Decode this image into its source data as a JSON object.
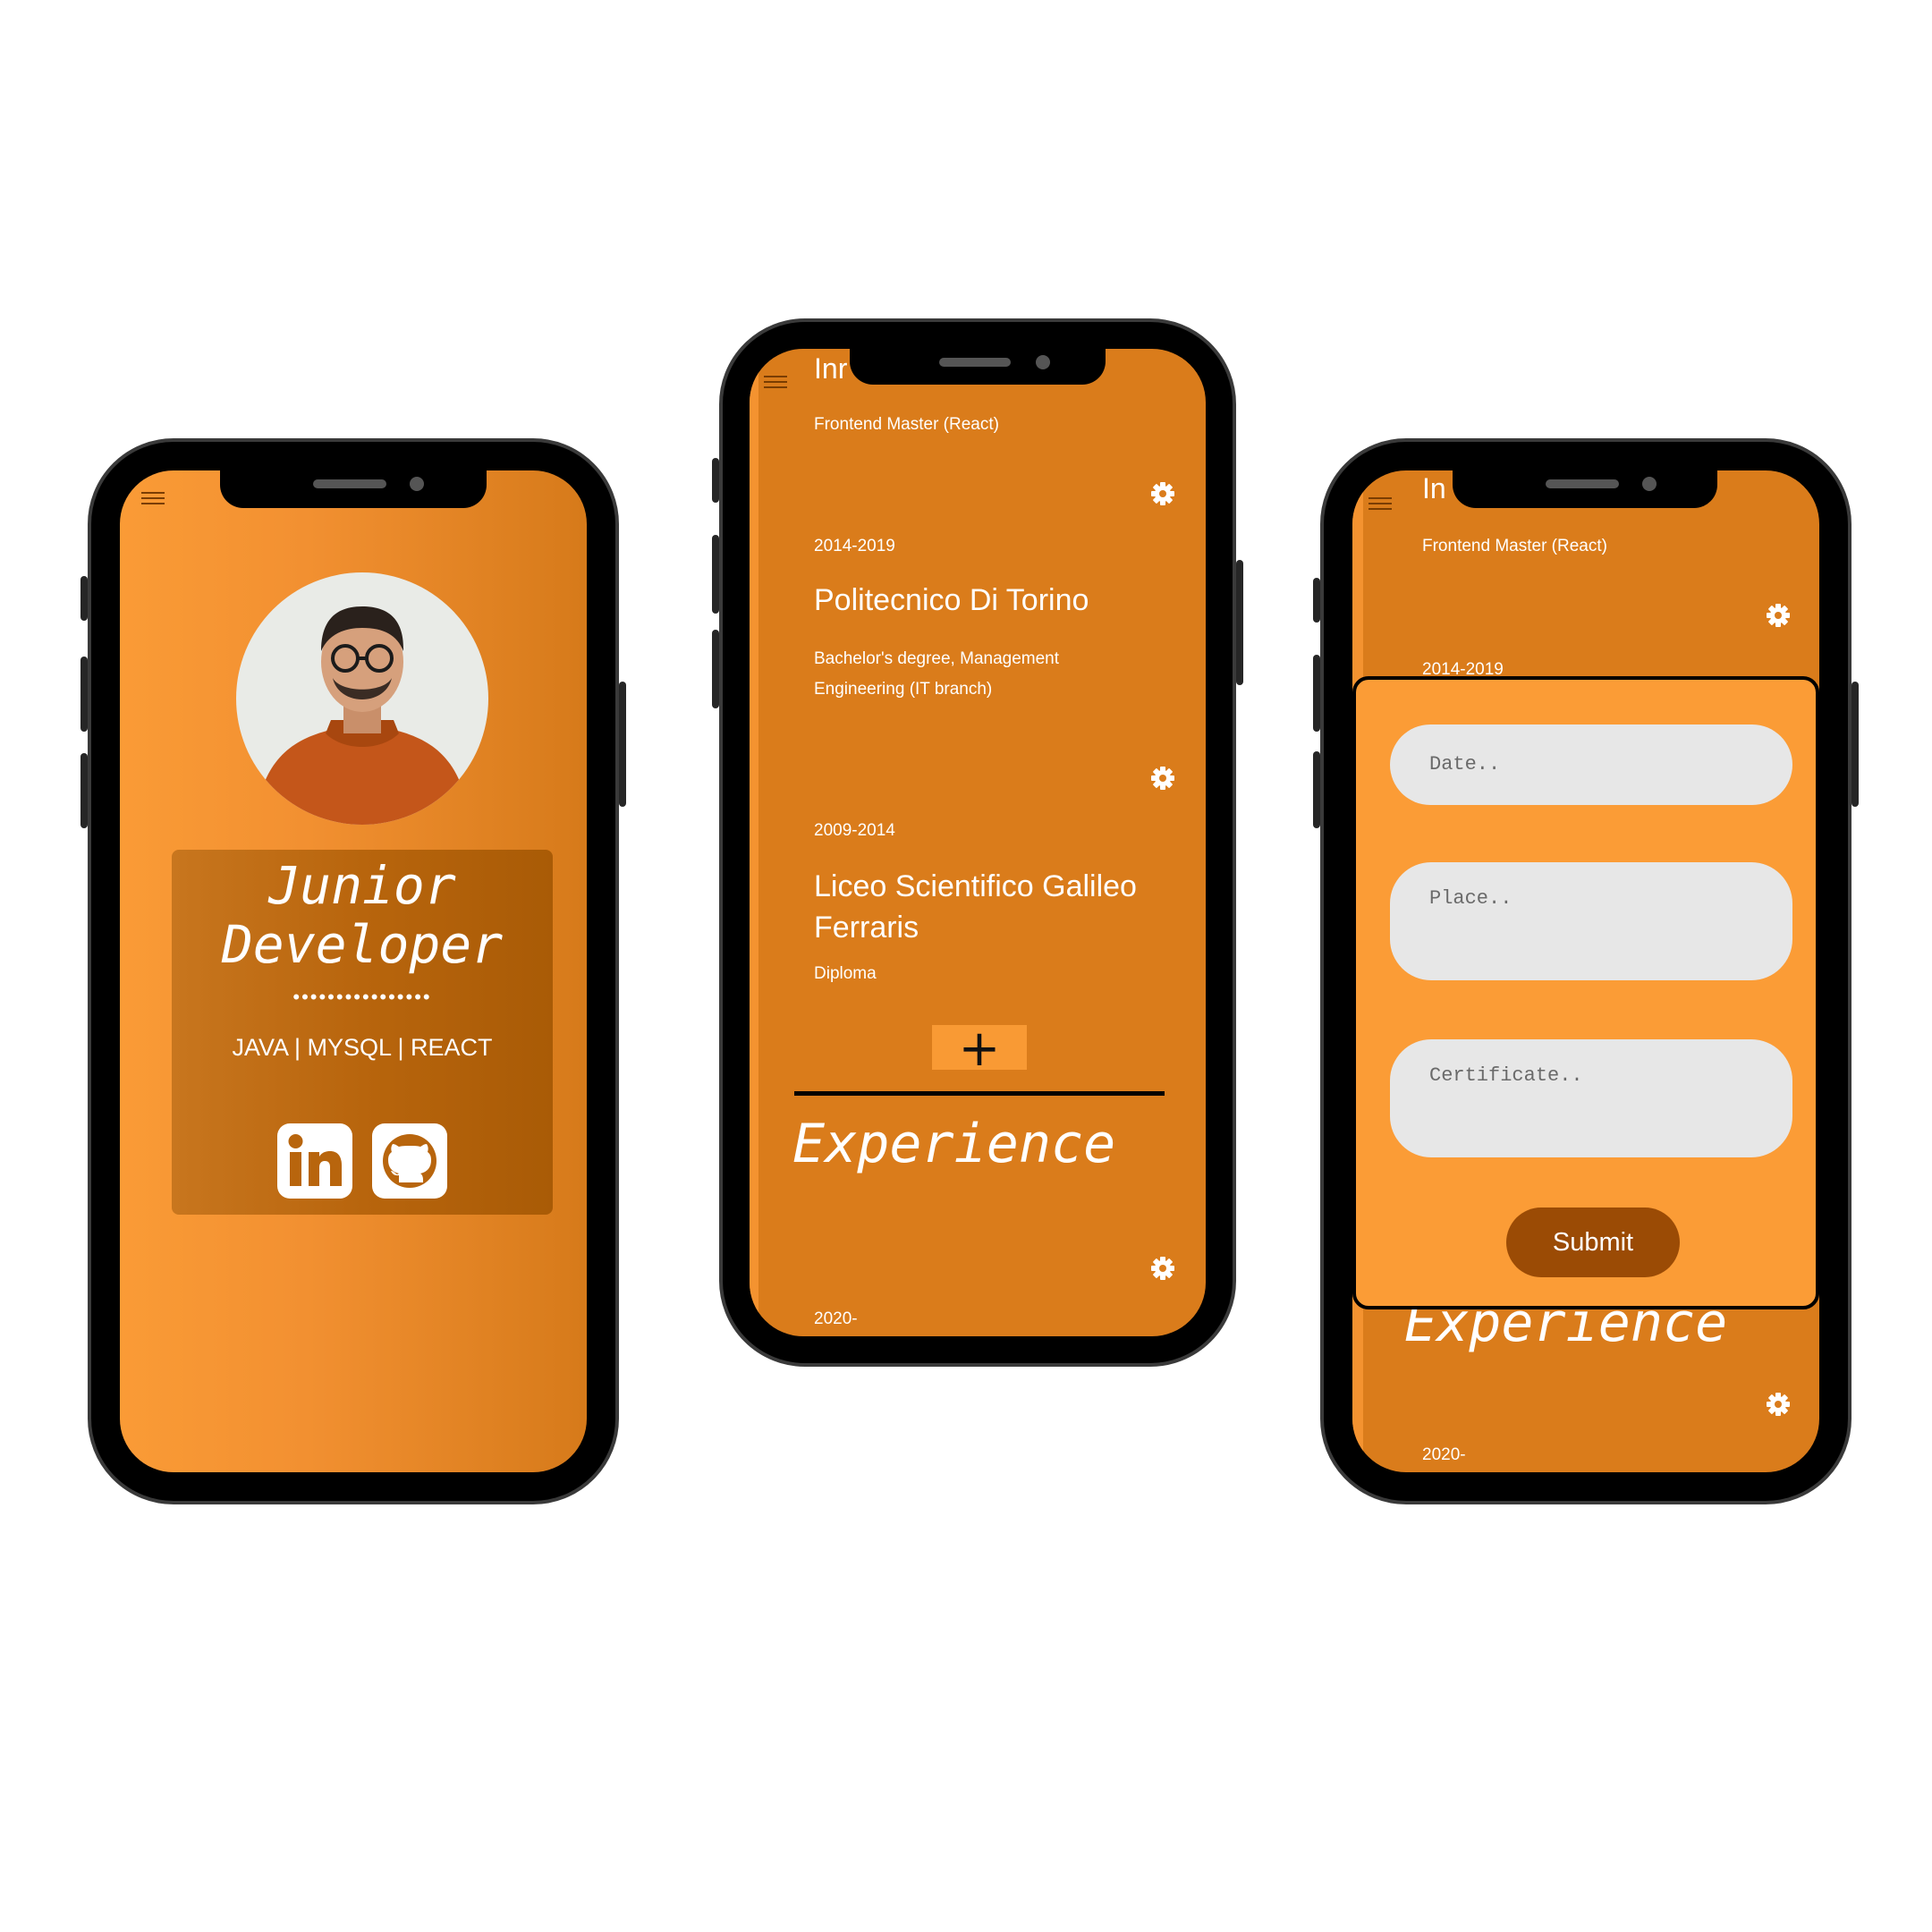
{
  "phone1": {
    "title_line1": "Junior",
    "title_line2": "Developer",
    "dots": "••••••••••••••••",
    "skills": "JAVA | MYSQL | REACT",
    "social": [
      "linkedin-icon",
      "github-icon"
    ],
    "colors": {
      "bg_start": "#fa9b36",
      "bg_end": "#d67a1a",
      "card": "#b8650d"
    }
  },
  "phone2": {
    "top_title": "Inr",
    "entries": [
      {
        "description": "Frontend Master (React)"
      },
      {
        "date": "2014-2019",
        "title": "Politecnico Di Torino",
        "desc_line1": "Bachelor's degree, Management",
        "desc_line2": "Engineering (IT branch)"
      },
      {
        "date": "2009-2014",
        "title_line1": "Liceo Scientifico Galileo",
        "title_line2": "Ferraris",
        "description": "Diploma"
      }
    ],
    "add_label": "+",
    "section_title": "Experience",
    "exp_date": "2020-",
    "colors": {
      "bg": "#da7c1b",
      "add_btn": "#f99a34"
    }
  },
  "phone3": {
    "top_title": "In",
    "description": "Frontend Master (React)",
    "date": "2014-2019",
    "form": {
      "date_placeholder": "Date..",
      "place_placeholder": "Place..",
      "certificate_placeholder": "Certificate..",
      "submit_label": "Submit"
    },
    "section_title": "Experience",
    "exp_date": "2020-",
    "colors": {
      "form_bg": "#fb9c36",
      "submit": "#9b4b05",
      "input": "#e7e7e7"
    }
  }
}
